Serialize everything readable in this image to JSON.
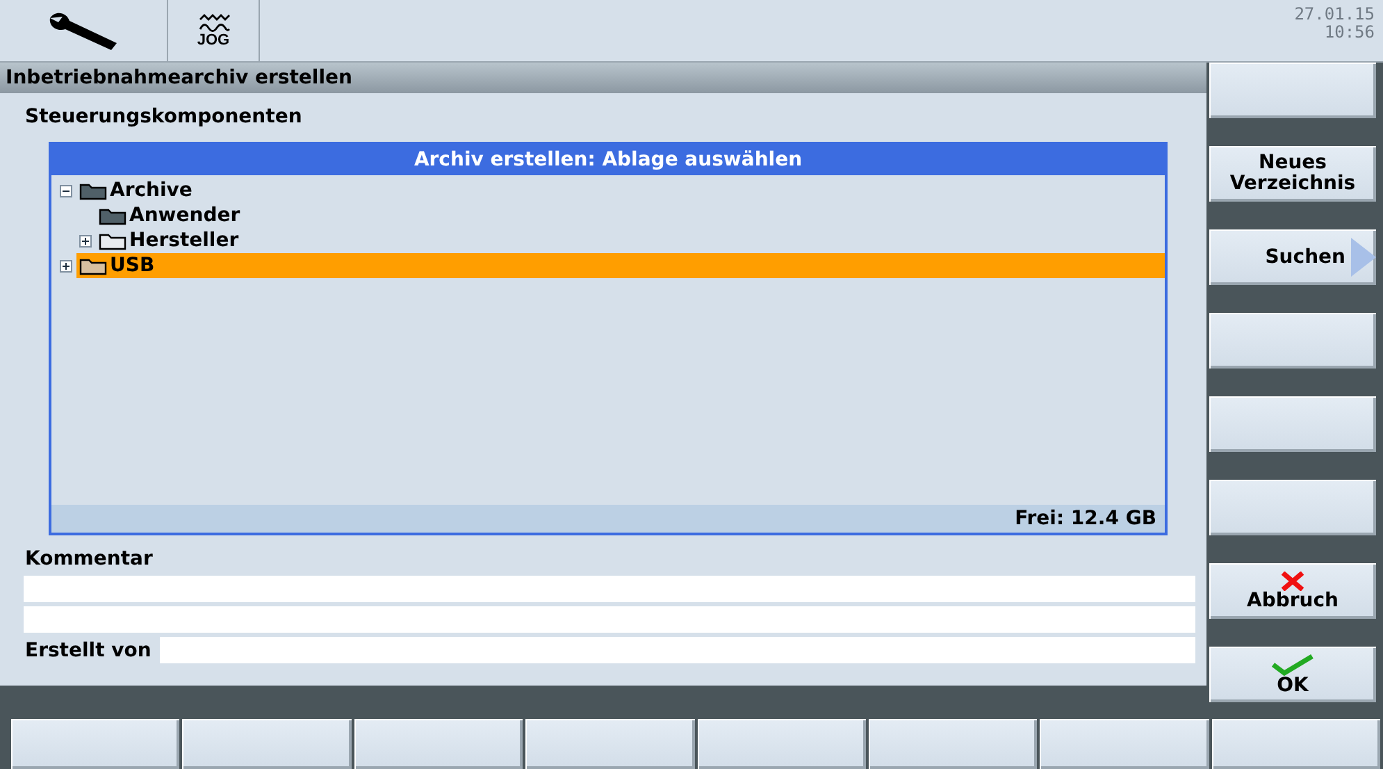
{
  "header": {
    "mode": "JOG",
    "date": "27.01.15",
    "time": "10:56"
  },
  "title": "Inbetriebnahmearchiv erstellen",
  "section_label": "Steuerungskomponenten",
  "dialog": {
    "title": "Archiv erstellen: Ablage auswählen",
    "tree": [
      {
        "label": "Archive",
        "expanded": true,
        "selected": false,
        "children": [
          {
            "label": "Anwender",
            "expanded": true,
            "selected": false
          },
          {
            "label": "Hersteller",
            "expanded": false,
            "selected": false
          }
        ]
      },
      {
        "label": "USB",
        "expanded": false,
        "selected": true
      }
    ],
    "status": "Frei: 12.4 GB"
  },
  "comment": {
    "label": "Kommentar"
  },
  "created_by": {
    "label": "Erstellt von"
  },
  "vertical_softkeys": [
    {
      "kind": "plain"
    },
    {
      "kind": "plain",
      "label": "Neues Verzeichnis"
    },
    {
      "kind": "menu",
      "label": "Suchen"
    },
    {
      "kind": "plain"
    },
    {
      "kind": "plain"
    },
    {
      "kind": "plain"
    },
    {
      "kind": "cancel",
      "label": "Abbruch"
    },
    {
      "kind": "confirm",
      "label": "OK"
    }
  ],
  "horizontal_softkeys": [
    {
      "kind": "plain"
    },
    {
      "kind": "plain"
    },
    {
      "kind": "plain"
    },
    {
      "kind": "plain"
    },
    {
      "kind": "plain"
    },
    {
      "kind": "plain"
    },
    {
      "kind": "plain"
    },
    {
      "kind": "plain"
    }
  ]
}
